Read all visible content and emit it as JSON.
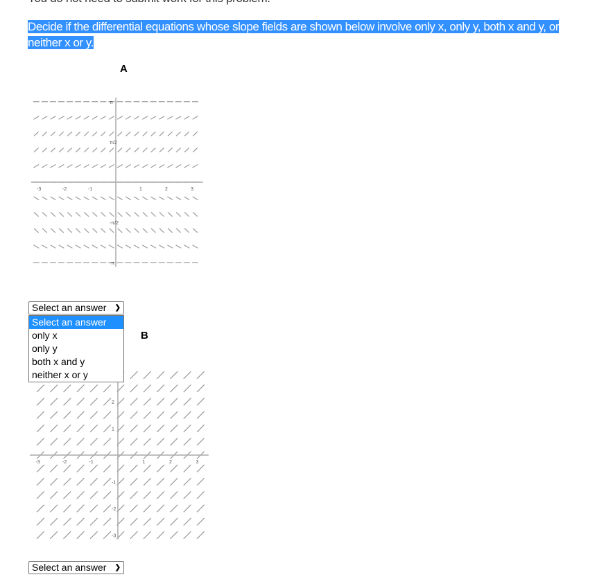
{
  "header": {
    "note": "You do not need to submit work for this problem.",
    "prompt": "Decide if the differential equations whose slope fields are shown below involve only x, only y,  both x and y, or neither x or y."
  },
  "questions": [
    {
      "label": "A",
      "select": {
        "value": "Select an answer",
        "open": true
      }
    },
    {
      "label": "B",
      "select": {
        "value": "Select an answer",
        "open": false
      }
    }
  ],
  "options": [
    "Select an answer",
    "only x",
    "only y",
    "both x and y",
    "neither x or y"
  ],
  "chart_data": [
    {
      "type": "slope_field",
      "title": "A",
      "xlim": [
        -3,
        3
      ],
      "ylim": [
        -3.14,
        3.14
      ],
      "x_ticks": [
        "-3",
        "-2",
        "-1",
        "1",
        "2",
        "3"
      ],
      "y_ticks": [
        "π",
        "π/2",
        "-π/2",
        "-π"
      ],
      "grid": false,
      "color": "#999999"
    },
    {
      "type": "slope_field",
      "title": "B",
      "xlim": [
        -3,
        3
      ],
      "ylim": [
        -3,
        3
      ],
      "x_ticks": [
        "-3",
        "-2",
        "-1",
        "1",
        "2",
        "3"
      ],
      "y_ticks": [
        "2",
        "1",
        "-1",
        "-2",
        "-3"
      ],
      "grid": false,
      "color": "#999999"
    }
  ]
}
